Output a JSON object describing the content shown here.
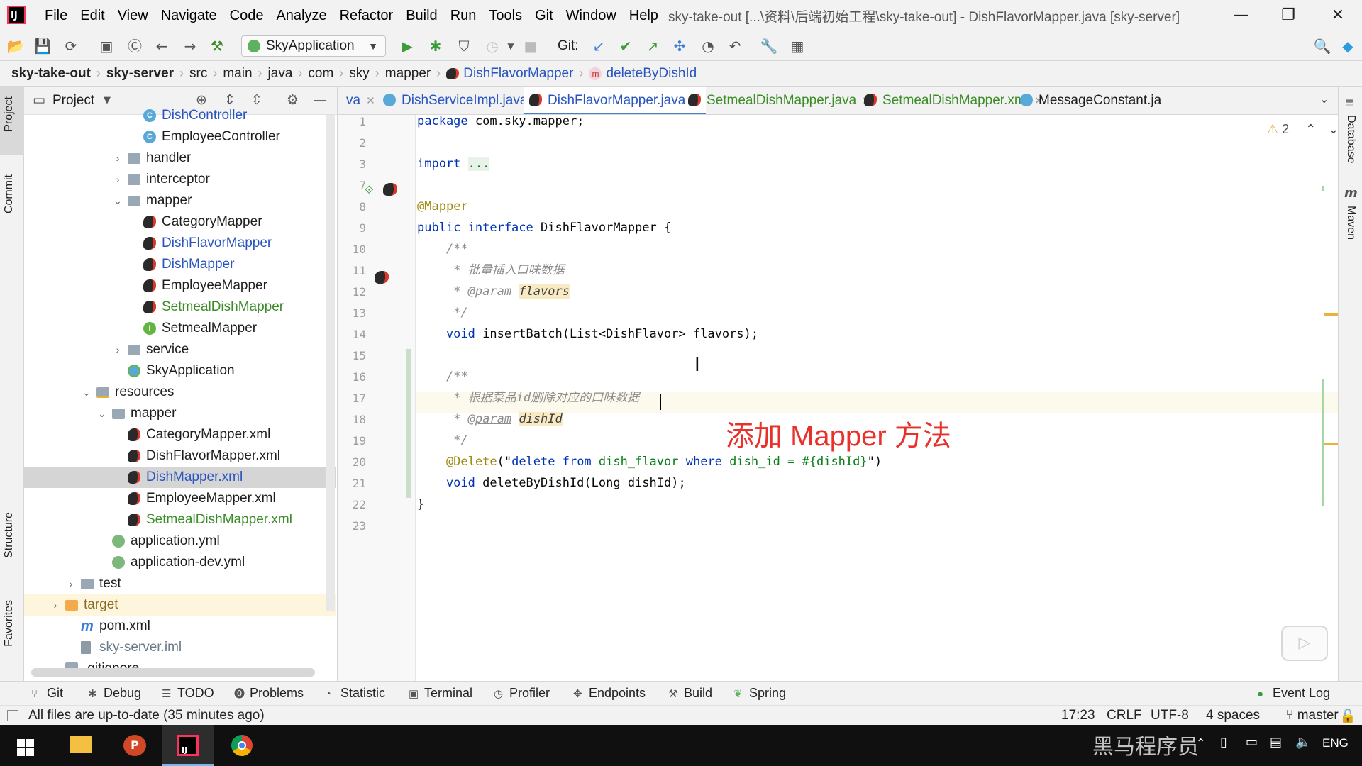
{
  "window": {
    "logo": "IJ",
    "title": "sky-take-out [...\\资料\\后端初始工程\\sky-take-out] - DishFlavorMapper.java [sky-server]",
    "controls": [
      "—",
      "❐",
      "✕"
    ]
  },
  "menu": [
    "File",
    "Edit",
    "View",
    "Navigate",
    "Code",
    "Analyze",
    "Refactor",
    "Build",
    "Run",
    "Tools",
    "Git",
    "Window",
    "Help"
  ],
  "toolbar": {
    "run_config": "SkyApplication",
    "git_label": "Git:"
  },
  "breadcrumb": [
    "sky-take-out",
    "sky-server",
    "src",
    "main",
    "java",
    "com",
    "sky",
    "mapper",
    "DishFlavorMapper",
    "deleteByDishId"
  ],
  "left_strip": [
    "Project",
    "Commit",
    "Structure",
    "Favorites"
  ],
  "right_strip": [
    "Database",
    "Maven"
  ],
  "project_panel": {
    "title": "Project",
    "tree": [
      {
        "label": "DishController",
        "indent": 6,
        "icon": "class",
        "color": "blue"
      },
      {
        "label": "EmployeeController",
        "indent": 6,
        "icon": "class",
        "color": ""
      },
      {
        "label": "handler",
        "indent": 5,
        "icon": "folder",
        "arrow": "›",
        "color": ""
      },
      {
        "label": "interceptor",
        "indent": 5,
        "icon": "folder",
        "arrow": "›",
        "color": ""
      },
      {
        "label": "mapper",
        "indent": 5,
        "icon": "folder",
        "arrow": "⌄",
        "color": ""
      },
      {
        "label": "CategoryMapper",
        "indent": 6,
        "icon": "bird",
        "color": ""
      },
      {
        "label": "DishFlavorMapper",
        "indent": 6,
        "icon": "bird",
        "color": "blue"
      },
      {
        "label": "DishMapper",
        "indent": 6,
        "icon": "bird",
        "color": "blue"
      },
      {
        "label": "EmployeeMapper",
        "indent": 6,
        "icon": "bird",
        "color": ""
      },
      {
        "label": "SetmealDishMapper",
        "indent": 6,
        "icon": "bird",
        "color": "green"
      },
      {
        "label": "SetmealMapper",
        "indent": 6,
        "icon": "interface",
        "color": ""
      },
      {
        "label": "service",
        "indent": 5,
        "icon": "folder",
        "arrow": "›",
        "color": ""
      },
      {
        "label": "SkyApplication",
        "indent": 5,
        "icon": "app",
        "color": ""
      },
      {
        "label": "resources",
        "indent": 3,
        "icon": "res",
        "arrow": "⌄",
        "color": ""
      },
      {
        "label": "mapper",
        "indent": 4,
        "icon": "folder",
        "arrow": "⌄",
        "color": ""
      },
      {
        "label": "CategoryMapper.xml",
        "indent": 5,
        "icon": "bird",
        "color": ""
      },
      {
        "label": "DishFlavorMapper.xml",
        "indent": 5,
        "icon": "bird",
        "color": ""
      },
      {
        "label": "DishMapper.xml",
        "indent": 5,
        "icon": "bird",
        "color": "blue",
        "selected": true
      },
      {
        "label": "EmployeeMapper.xml",
        "indent": 5,
        "icon": "bird",
        "color": ""
      },
      {
        "label": "SetmealDishMapper.xml",
        "indent": 5,
        "icon": "bird",
        "color": "green"
      },
      {
        "label": "application.yml",
        "indent": 4,
        "icon": "yml",
        "color": ""
      },
      {
        "label": "application-dev.yml",
        "indent": 4,
        "icon": "yml",
        "color": ""
      },
      {
        "label": "test",
        "indent": 2,
        "icon": "folder",
        "arrow": "›",
        "color": ""
      },
      {
        "label": "target",
        "indent": 1,
        "icon": "folder-orange",
        "arrow": "›",
        "color": "brown",
        "hl": true
      },
      {
        "label": "pom.xml",
        "indent": 2,
        "icon": "pom",
        "color": ""
      },
      {
        "label": "sky-server.iml",
        "indent": 2,
        "icon": "iml",
        "color": "gray"
      },
      {
        "label": ".gitignore",
        "indent": 1,
        "icon": "git",
        "color": ""
      }
    ]
  },
  "tabs": [
    {
      "label": "va",
      "icon": "",
      "active": false,
      "color": "#2a55c0"
    },
    {
      "label": "DishServiceImpl.java",
      "icon": "class",
      "active": false,
      "color": "#2a55c0"
    },
    {
      "label": "DishFlavorMapper.java",
      "icon": "bird",
      "active": true,
      "color": "#2a55c0"
    },
    {
      "label": "SetmealDishMapper.java",
      "icon": "bird",
      "active": false,
      "color": "#3c8c28"
    },
    {
      "label": "SetmealDishMapper.xml",
      "icon": "bird",
      "active": false,
      "color": "#3c8c28"
    },
    {
      "label": "MessageConstant.ja",
      "icon": "class",
      "active": false,
      "color": "#1e1e1e"
    }
  ],
  "editor": {
    "warnings": "⚠2",
    "line_numbers": [
      "1",
      "2",
      "3",
      "7",
      "8",
      "9",
      "10",
      "11",
      "12",
      "13",
      "14",
      "15",
      "16",
      "17",
      "18",
      "19",
      "20",
      "21",
      "22",
      "23"
    ],
    "lines": [
      [
        {
          "t": "package",
          "c": "kw"
        },
        {
          "t": " com.sky.mapper;",
          "c": ""
        }
      ],
      [],
      [
        {
          "t": "import",
          "c": "kw"
        },
        {
          "t": " ",
          "c": ""
        },
        {
          "t": "...",
          "c": "fold"
        }
      ],
      [],
      [
        {
          "t": "@Mapper",
          "c": "ann"
        }
      ],
      [
        {
          "t": "public interface",
          "c": "kw"
        },
        {
          "t": " DishFlavorMapper {",
          "c": ""
        }
      ],
      [
        {
          "t": "    /**",
          "c": "cm"
        }
      ],
      [
        {
          "t": "     * 批量插入口味数据",
          "c": "cm"
        }
      ],
      [
        {
          "t": "     * ",
          "c": "cm"
        },
        {
          "t": "@param",
          "c": "doctag"
        },
        {
          "t": " ",
          "c": "cm"
        },
        {
          "t": "flavors",
          "c": "docparam"
        }
      ],
      [
        {
          "t": "     */",
          "c": "cm"
        }
      ],
      [
        {
          "t": "    void",
          "c": "kw"
        },
        {
          "t": " insertBatch(List<DishFlavor> flavors);",
          "c": ""
        }
      ],
      [],
      [
        {
          "t": "    /**",
          "c": "cm"
        }
      ],
      [
        {
          "t": "     * 根据菜品id删除对应的口味数据",
          "c": "cm"
        }
      ],
      [
        {
          "t": "     * ",
          "c": "cm"
        },
        {
          "t": "@param",
          "c": "doctag"
        },
        {
          "t": " ",
          "c": "cm"
        },
        {
          "t": "dishId",
          "c": "docparam"
        }
      ],
      [
        {
          "t": "     */",
          "c": "cm"
        }
      ],
      [
        {
          "t": "    @Delete",
          "c": "ann"
        },
        {
          "t": "(\"",
          "c": ""
        },
        {
          "t": "delete from",
          "c": "sqlkw"
        },
        {
          "t": " dish_flavor ",
          "c": "str"
        },
        {
          "t": "where",
          "c": "sqlkw"
        },
        {
          "t": " dish_id = #{dishId}",
          "c": "str"
        },
        {
          "t": "\")",
          "c": ""
        }
      ],
      [
        {
          "t": "    void",
          "c": "kw"
        },
        {
          "t": " deleteByDishId(Long dishId);",
          "c": ""
        }
      ],
      [
        {
          "t": "}",
          "c": ""
        }
      ],
      []
    ]
  },
  "caption": "添加 Mapper 方法",
  "bottom_tools": [
    "Git",
    "Debug",
    "TODO",
    "Problems",
    "Statistic",
    "Terminal",
    "Profiler",
    "Endpoints",
    "Build",
    "Spring",
    "Event Log"
  ],
  "status": {
    "message": "All files are up-to-date (35 minutes ago)",
    "position": "17:23",
    "line_sep": "CRLF",
    "encoding": "UTF-8",
    "indent": "4 spaces",
    "branch": "master"
  },
  "taskbar": {
    "ime": "ENG",
    "watermark": "黑马程序员"
  },
  "colors": {
    "caption": "#e8312a",
    "keyword": "#0033b3",
    "annotation": "#9e880d",
    "string": "#067d17",
    "active_tab": "#4083c9"
  }
}
